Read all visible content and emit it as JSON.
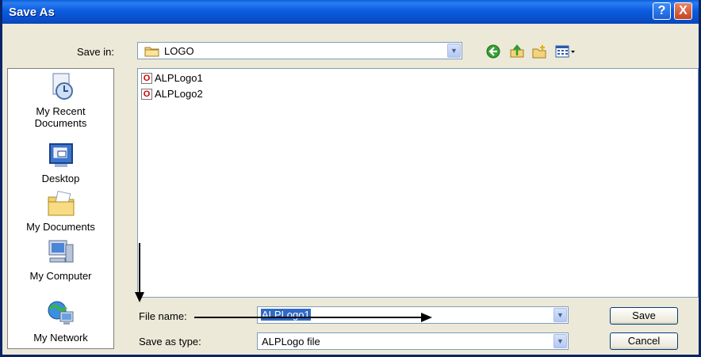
{
  "window": {
    "title": "Save As"
  },
  "titlebar": {
    "help_glyph": "?",
    "close_glyph": "X"
  },
  "save_in": {
    "label": "Save in:",
    "value": "LOGO"
  },
  "toolbar": {
    "icons": [
      "back-icon",
      "up-folder-icon",
      "new-folder-icon",
      "views-menu-icon"
    ]
  },
  "places": [
    {
      "label": "My Recent Documents",
      "line1": "My Recent",
      "line2": "Documents",
      "icon": "recent-documents-icon"
    },
    {
      "label": "Desktop",
      "icon": "desktop-icon"
    },
    {
      "label": "My Documents",
      "icon": "my-documents-icon"
    },
    {
      "label": "My Computer",
      "icon": "my-computer-icon"
    },
    {
      "label": "My Network",
      "icon": "my-network-icon"
    }
  ],
  "files": [
    {
      "name": "ALPLogo1",
      "icon": "opera-file-icon"
    },
    {
      "name": "ALPLogo2",
      "icon": "opera-file-icon"
    }
  ],
  "file_name": {
    "label": "File name:",
    "value": "ALPLogo1"
  },
  "save_as_type": {
    "label": "Save as type:",
    "value": "ALPLogo file"
  },
  "buttons": {
    "save": "Save",
    "cancel": "Cancel"
  },
  "colors": {
    "titlebar": "#0a5fd8",
    "dialog_bg": "#ece9d8",
    "selection": "#316ac5"
  }
}
